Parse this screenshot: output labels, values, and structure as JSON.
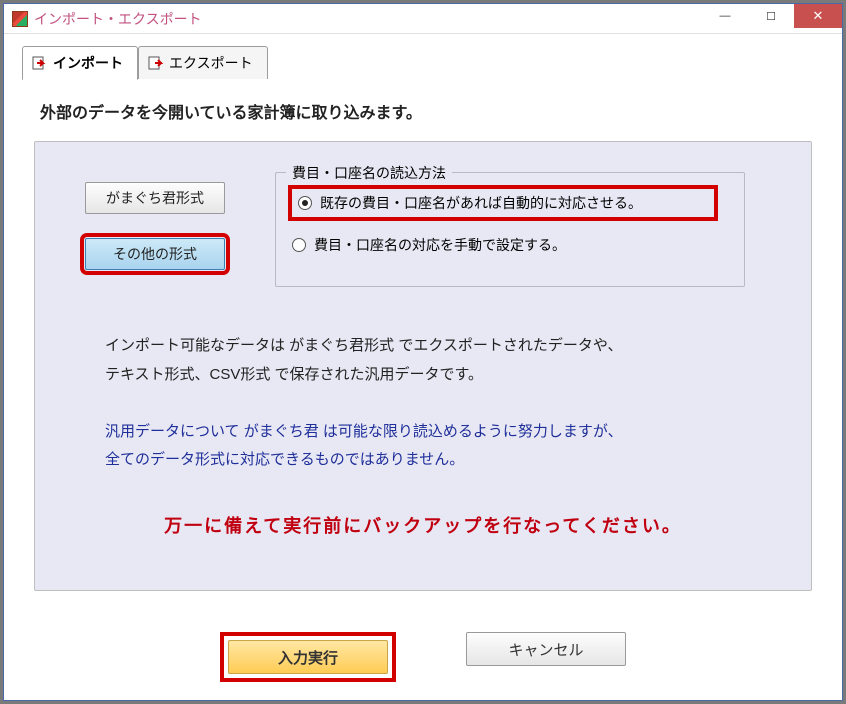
{
  "window": {
    "title": "インポート・エクスポート"
  },
  "tabs": {
    "import_label": "インポート",
    "export_label": "エクスポート"
  },
  "heading": "外部のデータを今開いている家計簿に取り込みます。",
  "format_buttons": {
    "gamaguchi": "がまぐち君形式",
    "other": "その他の形式"
  },
  "readmethod": {
    "legend": "費目・口座名の読込方法",
    "opt_auto": "既存の費目・口座名があれば自動的に対応させる。",
    "opt_manual": "費目・口座名の対応を手動で設定する。"
  },
  "info": {
    "line1": "インポート可能なデータは  がまぐち君形式  でエクスポートされたデータや、",
    "line2": "テキスト形式、CSV形式  で保存された汎用データです。",
    "line3": "汎用データについて がまぐち君 は可能な限り読込めるように努力しますが、",
    "line4": "全てのデータ形式に対応できるものではありません。"
  },
  "warning": "万一に備えて実行前にバックアップを行なってください。",
  "actions": {
    "execute": "入力実行",
    "cancel": "キャンセル"
  }
}
